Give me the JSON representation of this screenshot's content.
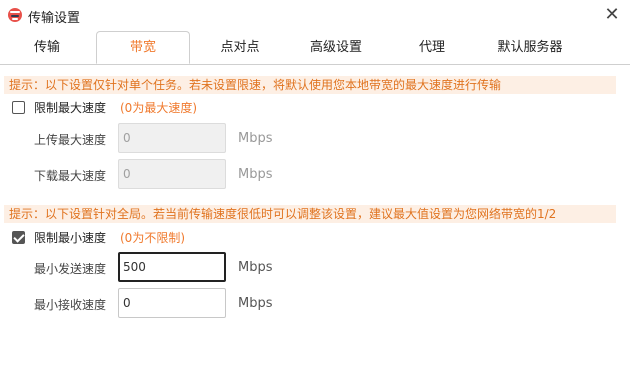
{
  "window": {
    "title": "传输设置",
    "close_symbol": "✕"
  },
  "tabs": [
    {
      "label": "传输"
    },
    {
      "label": "带宽",
      "active": true
    },
    {
      "label": "点对点"
    },
    {
      "label": "高级设置"
    },
    {
      "label": "代理"
    },
    {
      "label": "默认服务器"
    }
  ],
  "max_section": {
    "tip": "提示：以下设置仅针对单个任务。若未设置限速，将默认使用您本地带宽的最大速度进行传输",
    "checkbox_label": "限制最大速度",
    "checked": false,
    "hint": "(0为最大速度)",
    "upload": {
      "label": "上传最大速度",
      "value": "0",
      "unit": "Mbps"
    },
    "download": {
      "label": "下载最大速度",
      "value": "0",
      "unit": "Mbps"
    }
  },
  "min_section": {
    "tip": "提示：以下设置针对全局。若当前传输速度很低时可以调整该设置，建议最大值设置为您网络带宽的1/2",
    "checkbox_label": "限制最小速度",
    "checked": true,
    "hint": "(0为不限制)",
    "send": {
      "label": "最小发送速度",
      "value": "500",
      "unit": "Mbps"
    },
    "receive": {
      "label": "最小接收速度",
      "value": "0",
      "unit": "Mbps"
    }
  },
  "colors": {
    "accent": "#f07a2e",
    "tip_bg": "#fdefe4",
    "tip_text": "#e0731f"
  }
}
